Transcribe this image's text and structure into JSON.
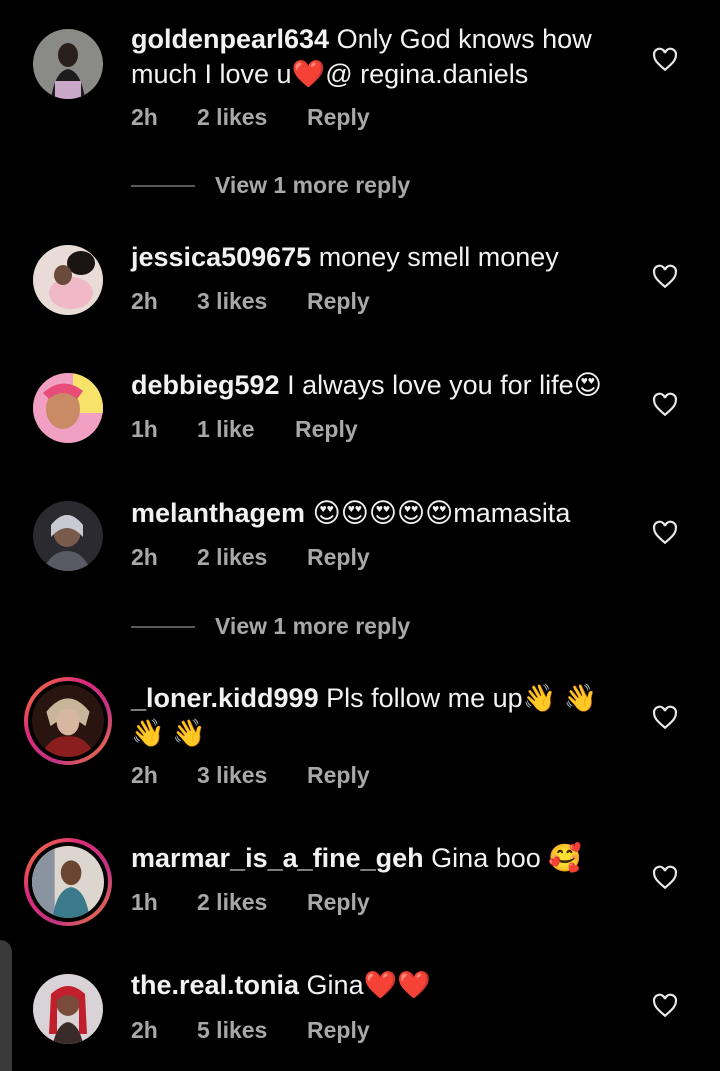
{
  "comments": [
    {
      "username": "goldenpearl634",
      "text": " Only God knows how much I love u❤️@ regina.daniels",
      "time": "2h",
      "likes": "2 likes",
      "reply": "Reply",
      "view_more": "View 1 more reply"
    },
    {
      "username": "jessica509675",
      "text": " money smell money",
      "time": "2h",
      "likes": "3 likes",
      "reply": "Reply"
    },
    {
      "username": "debbieg592",
      "text": " I always love you for life😍",
      "time": "1h",
      "likes": "1 like",
      "reply": "Reply"
    },
    {
      "username": "melanthagem",
      "text": " 😍😍😍😍😍mamasita",
      "time": "2h",
      "likes": "2 likes",
      "reply": "Reply",
      "view_more": "View 1 more reply"
    },
    {
      "username": "_loner.kidd999",
      "text": " Pls follow me up👋 👋 👋 👋",
      "time": "2h",
      "likes": "3 likes",
      "reply": "Reply"
    },
    {
      "username": "marmar_is_a_fine_geh",
      "text": " Gina boo 🥰",
      "time": "1h",
      "likes": "2 likes",
      "reply": "Reply"
    },
    {
      "username": "the.real.tonia",
      "text": " Gina❤️❤️",
      "time": "2h",
      "likes": "5 likes",
      "reply": "Reply"
    }
  ],
  "colors": {
    "background": "#000000",
    "text": "#f2f2f2",
    "secondary": "#a8a8a8",
    "story_ring": "#dd2a7b"
  }
}
